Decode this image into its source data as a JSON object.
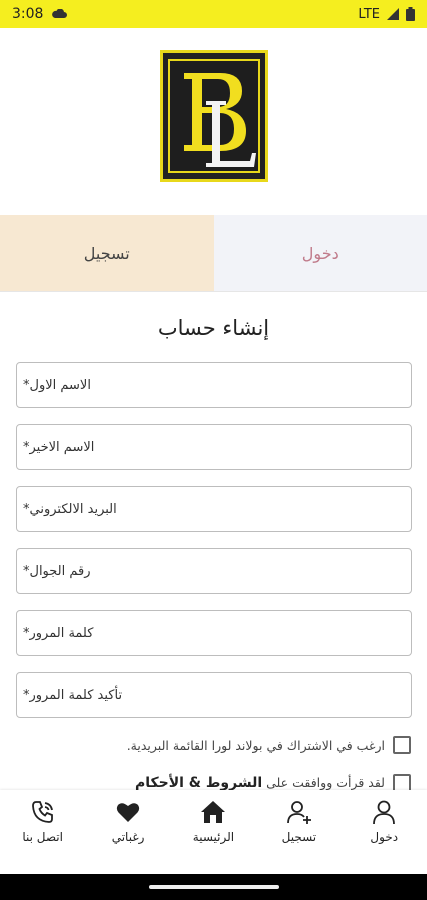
{
  "status_bar": {
    "time": "3:08",
    "network": "LTE"
  },
  "tabs": {
    "login": "دخول",
    "register": "تسجيل"
  },
  "form": {
    "title": "إنشاء حساب",
    "fields": [
      {
        "label": "الاسم الاول",
        "required": "*"
      },
      {
        "label": "الاسم الاخير",
        "required": "*"
      },
      {
        "label": "البريد الالكتروني",
        "required": "*"
      },
      {
        "label": "رقم الجوال",
        "required": "*"
      },
      {
        "label": "كلمة المرور",
        "required": "*"
      },
      {
        "label": "تأكيد كلمة المرور",
        "required": "*"
      }
    ],
    "newsletter_label": "ارغب في الاشتراك في بولاند لورا القائمة البريدية.",
    "terms_prefix": "لقد قرأت ووافقت على",
    "terms_link": "الشروط & الأحكام"
  },
  "bottom_nav": [
    {
      "label": "اتصل بنا",
      "icon": "phone-icon"
    },
    {
      "label": "رغباتي",
      "icon": "heart-icon"
    },
    {
      "label": "الرئيسية",
      "icon": "home-icon"
    },
    {
      "label": "تسجيل",
      "icon": "add-user-icon"
    },
    {
      "label": "دخول",
      "icon": "user-icon"
    }
  ]
}
